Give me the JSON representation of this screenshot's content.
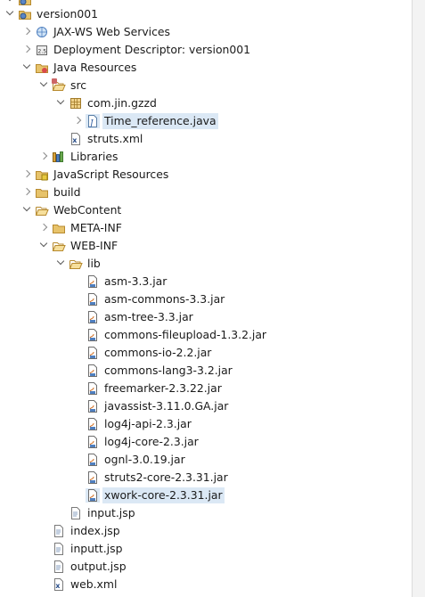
{
  "tree": {
    "rows": [
      {
        "label": "version001",
        "icon": "web-project-icon",
        "depth": 0,
        "twisty": "expanded"
      },
      {
        "label": "JAX-WS Web Services",
        "icon": "web-services-icon",
        "depth": 1,
        "twisty": "collapsed"
      },
      {
        "label": "Deployment Descriptor: version001",
        "icon": "deployment-descriptor-icon",
        "depth": 1,
        "twisty": "collapsed"
      },
      {
        "label": "Java Resources",
        "icon": "java-resources-icon",
        "depth": 1,
        "twisty": "expanded"
      },
      {
        "label": "src",
        "icon": "source-folder-icon",
        "depth": 2,
        "twisty": "expanded"
      },
      {
        "label": "com.jin.gzzd",
        "icon": "package-icon",
        "depth": 3,
        "twisty": "expanded"
      },
      {
        "label": "Time_reference.java",
        "icon": "java-file-icon",
        "depth": 4,
        "twisty": "collapsed",
        "selected": true
      },
      {
        "label": "struts.xml",
        "icon": "xml-file-icon",
        "depth": 3,
        "twisty": "none"
      },
      {
        "label": "Libraries",
        "icon": "libraries-icon",
        "depth": 2,
        "twisty": "collapsed"
      },
      {
        "label": "JavaScript Resources",
        "icon": "javascript-resources-icon",
        "depth": 1,
        "twisty": "collapsed"
      },
      {
        "label": "build",
        "icon": "folder-icon",
        "depth": 1,
        "twisty": "collapsed"
      },
      {
        "label": "WebContent",
        "icon": "folder-open-icon",
        "depth": 1,
        "twisty": "expanded"
      },
      {
        "label": "META-INF",
        "icon": "folder-icon",
        "depth": 2,
        "twisty": "collapsed"
      },
      {
        "label": "WEB-INF",
        "icon": "folder-open-icon",
        "depth": 2,
        "twisty": "expanded"
      },
      {
        "label": "lib",
        "icon": "folder-open-icon",
        "depth": 3,
        "twisty": "expanded"
      },
      {
        "label": "asm-3.3.jar",
        "icon": "jar-icon",
        "depth": 4,
        "twisty": "none"
      },
      {
        "label": "asm-commons-3.3.jar",
        "icon": "jar-icon",
        "depth": 4,
        "twisty": "none"
      },
      {
        "label": "asm-tree-3.3.jar",
        "icon": "jar-icon",
        "depth": 4,
        "twisty": "none"
      },
      {
        "label": "commons-fileupload-1.3.2.jar",
        "icon": "jar-icon",
        "depth": 4,
        "twisty": "none"
      },
      {
        "label": "commons-io-2.2.jar",
        "icon": "jar-icon",
        "depth": 4,
        "twisty": "none"
      },
      {
        "label": "commons-lang3-3.2.jar",
        "icon": "jar-icon",
        "depth": 4,
        "twisty": "none"
      },
      {
        "label": "freemarker-2.3.22.jar",
        "icon": "jar-icon",
        "depth": 4,
        "twisty": "none"
      },
      {
        "label": "javassist-3.11.0.GA.jar",
        "icon": "jar-icon",
        "depth": 4,
        "twisty": "none"
      },
      {
        "label": "log4j-api-2.3.jar",
        "icon": "jar-icon",
        "depth": 4,
        "twisty": "none"
      },
      {
        "label": "log4j-core-2.3.jar",
        "icon": "jar-icon",
        "depth": 4,
        "twisty": "none"
      },
      {
        "label": "ognl-3.0.19.jar",
        "icon": "jar-icon",
        "depth": 4,
        "twisty": "none"
      },
      {
        "label": "struts2-core-2.3.31.jar",
        "icon": "jar-icon",
        "depth": 4,
        "twisty": "none"
      },
      {
        "label": "xwork-core-2.3.31.jar",
        "icon": "jar-icon",
        "depth": 4,
        "twisty": "none",
        "selected": true
      },
      {
        "label": "input.jsp",
        "icon": "jsp-file-icon",
        "depth": 3,
        "twisty": "none"
      },
      {
        "label": "index.jsp",
        "icon": "jsp-file-icon",
        "depth": 2,
        "twisty": "none"
      },
      {
        "label": "inputt.jsp",
        "icon": "jsp-file-icon",
        "depth": 2,
        "twisty": "none"
      },
      {
        "label": "output.jsp",
        "icon": "jsp-file-icon",
        "depth": 2,
        "twisty": "none"
      },
      {
        "label": "web.xml",
        "icon": "xml-file-icon",
        "depth": 2,
        "twisty": "none"
      }
    ]
  },
  "colors": {
    "selection": "#d6e6f6",
    "folder": "#e7c36b",
    "folder_edge": "#b78a2e",
    "jar": "#4f7fbf"
  }
}
